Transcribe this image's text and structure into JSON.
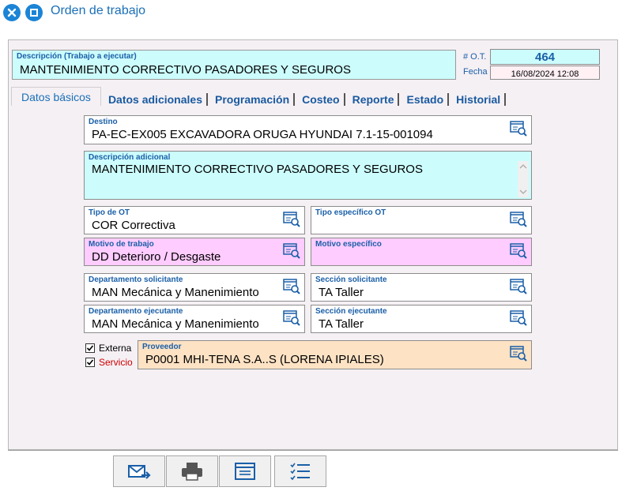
{
  "window": {
    "title": "Orden de trabajo"
  },
  "header": {
    "description_label": "Descripción (Trabajo a ejecutar)",
    "description_value": "MANTENIMIENTO CORRECTIVO PASADORES Y SEGUROS",
    "ot_label": "# O.T.",
    "ot_value": "464",
    "fecha_label": "Fecha",
    "fecha_value": "16/08/2024 12:08"
  },
  "tabs": [
    {
      "label": "Datos básicos",
      "active": true
    },
    {
      "label": "Datos adicionales",
      "active": false
    },
    {
      "label": "Programación",
      "active": false
    },
    {
      "label": "Costeo",
      "active": false
    },
    {
      "label": "Reporte",
      "active": false
    },
    {
      "label": "Estado",
      "active": false
    },
    {
      "label": "Historial",
      "active": false
    }
  ],
  "form": {
    "destino": {
      "label": "Destino",
      "value": "PA-EC-EX005 EXCAVADORA ORUGA HYUNDAI 7.1-15-001094"
    },
    "descripcion_adicional": {
      "label": "Descripción adicional",
      "value": "MANTENIMIENTO CORRECTIVO PASADORES Y SEGUROS"
    },
    "tipo_ot": {
      "label": "Tipo de OT",
      "value": "COR Correctiva"
    },
    "tipo_especifico": {
      "label": "Tipo específico OT",
      "value": ""
    },
    "motivo_trabajo": {
      "label": "Motivo de trabajo",
      "value": "DD Deterioro / Desgaste"
    },
    "motivo_especifico": {
      "label": "Motivo específico",
      "value": ""
    },
    "dep_solicitante": {
      "label": "Departamento solicitante",
      "value": "MAN Mecánica y Manenimiento"
    },
    "sec_solicitante": {
      "label": "Sección solicitante",
      "value": "TA Taller"
    },
    "dep_ejecutante": {
      "label": "Departamento ejecutante",
      "value": "MAN Mecánica y Manenimiento"
    },
    "sec_ejecutante": {
      "label": "Sección ejecutante",
      "value": "TA Taller"
    },
    "externa": {
      "label": "Externa",
      "checked": true
    },
    "servicio": {
      "label": "Servicio",
      "checked": true
    },
    "proveedor": {
      "label": "Proveedor",
      "value": "P0001 MHI-TENA S.A..S (LORENA IPIALES)"
    }
  },
  "toolbar": {
    "icons": [
      "mail-send-icon",
      "printer-icon",
      "window-list-icon",
      "checklist-icon"
    ]
  },
  "colors": {
    "accent": "#1b84d6",
    "label_blue": "#1a5fa8",
    "cyan_field": "#ccfcfc",
    "pink_field": "#ffccff",
    "peach_field": "#fde2c4",
    "servicio_red": "#cc0000"
  }
}
